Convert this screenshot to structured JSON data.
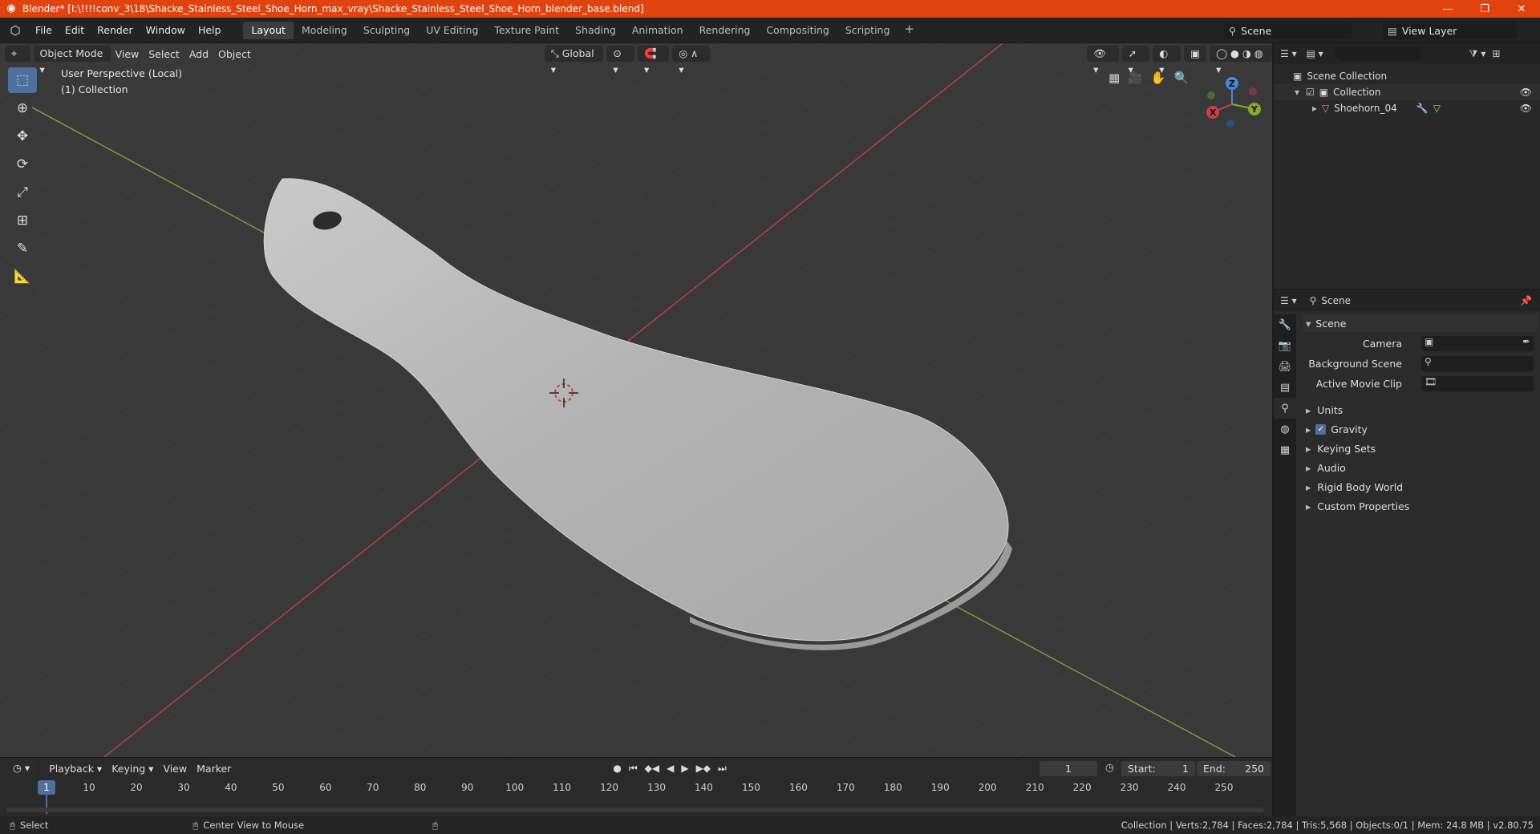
{
  "window": {
    "title": "Blender* [I:\\!!!!conv_3\\18\\Shacke_Stainless_Steel_Shoe_Horn_max_vray\\Shacke_Stainless_Steel_Shoe_Horn_blender_base.blend]",
    "minimize": "—",
    "restore": "❐",
    "close": "✕"
  },
  "menubar": {
    "items": [
      "File",
      "Edit",
      "Render",
      "Window",
      "Help"
    ]
  },
  "workspaces": {
    "tabs": [
      "Layout",
      "Modeling",
      "Sculpting",
      "UV Editing",
      "Texture Paint",
      "Shading",
      "Animation",
      "Rendering",
      "Compositing",
      "Scripting"
    ],
    "active": "Layout",
    "add": "+"
  },
  "scene_selector": {
    "scene": "Scene",
    "view_layer": "View Layer"
  },
  "viewport": {
    "mode": "Object Mode",
    "menus": [
      "View",
      "Select",
      "Add",
      "Object"
    ],
    "transform_orientation": "Global",
    "overlay_line1": "User Perspective (Local)",
    "overlay_line2": "(1) Collection",
    "gizmo": {
      "x": "X",
      "y": "Y",
      "z": "Z"
    }
  },
  "outliner": {
    "search_placeholder": "",
    "root": "Scene Collection",
    "collection": "Collection",
    "object": "Shoehorn_04"
  },
  "properties": {
    "context": "Scene",
    "panel_title": "Scene",
    "camera_label": "Camera",
    "background_scene_label": "Background Scene",
    "active_movie_clip_label": "Active Movie Clip",
    "sections": [
      "Units",
      "Gravity",
      "Keying Sets",
      "Audio",
      "Rigid Body World",
      "Custom Properties"
    ],
    "gravity_checked": true
  },
  "timeline": {
    "menus": [
      "Playback",
      "Keying",
      "View",
      "Marker"
    ],
    "current_frame": "1",
    "start_label": "Start:",
    "start": "1",
    "end_label": "End:",
    "end": "250",
    "ticks": [
      "1",
      "10",
      "20",
      "30",
      "40",
      "50",
      "60",
      "70",
      "80",
      "90",
      "100",
      "110",
      "120",
      "130",
      "140",
      "150",
      "160",
      "170",
      "180",
      "190",
      "200",
      "210",
      "220",
      "230",
      "240",
      "250"
    ]
  },
  "statusbar": {
    "left": "Select",
    "middle": "Center View to Mouse",
    "right": "Collection | Verts:2,784 | Faces:2,784 | Tris:5,568 | Objects:0/1 | Mem: 24.8 MB | v2.80.75"
  },
  "colors": {
    "titlebar": "#e0430f",
    "viewport_bg": "#393939",
    "x_axis": "#c8404c",
    "y_axis": "#86a92e",
    "active_tool": "#4f6f9c"
  }
}
